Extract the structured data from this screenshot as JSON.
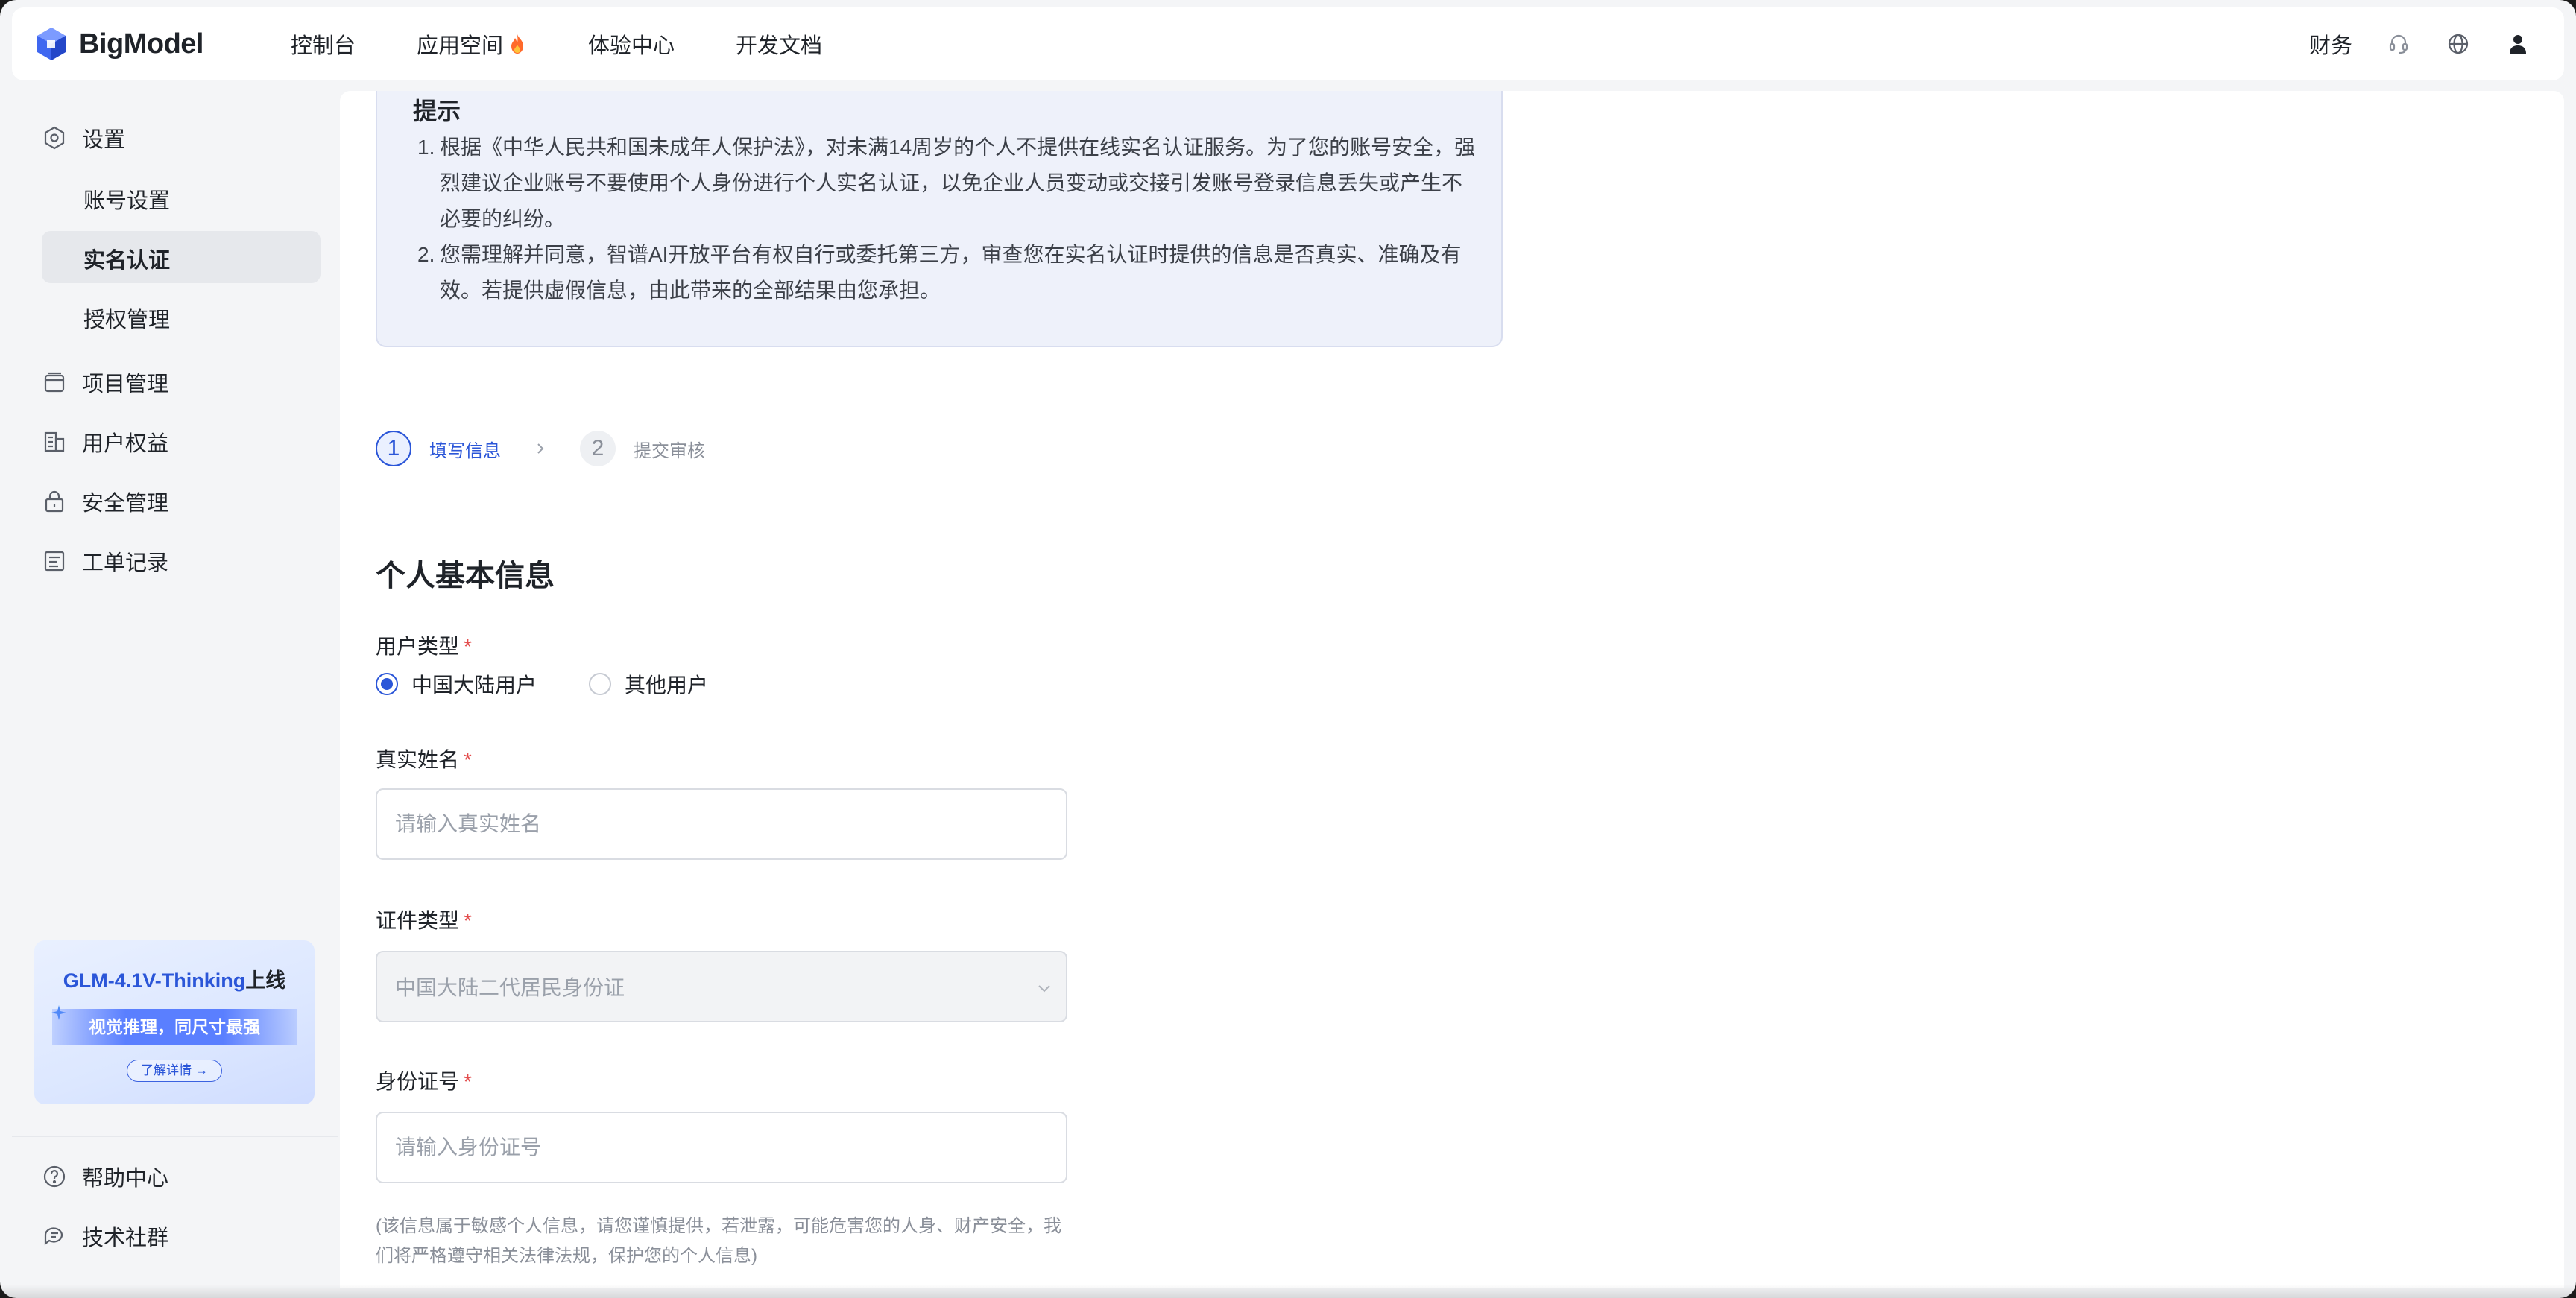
{
  "header": {
    "brand": "BigModel",
    "nav": [
      {
        "label": "控制台"
      },
      {
        "label": "应用空间"
      },
      {
        "label": "体验中心"
      },
      {
        "label": "开发文档"
      }
    ],
    "finance": "财务"
  },
  "sidebar": {
    "settings": "设置",
    "sub_items": [
      "账号设置",
      "实名认证",
      "授权管理"
    ],
    "active_sub": "实名认证",
    "items": [
      "项目管理",
      "用户权益",
      "安全管理",
      "工单记录"
    ],
    "promo": {
      "model": "GLM-4.1V-Thinking",
      "suffix": "上线",
      "tagline": "视觉推理，同尺寸最强",
      "button": "了解详情 →"
    },
    "help": "帮助中心",
    "community": "技术社群"
  },
  "notice": {
    "title": "提示",
    "items": [
      {
        "num": "1.",
        "text": "根据《中华人民共和国未成年人保护法》，对未满14周岁的个人不提供在线实名认证服务。为了您的账号安全，强烈建议企业账号不要使用个人身份进行个人实名认证，以免企业人员变动或交接引发账号登录信息丢失或产生不必要的纠纷。"
      },
      {
        "num": "2.",
        "text": "您需理解并同意，智谱AI开放平台有权自行或委托第三方，审查您在实名认证时提供的信息是否真实、准确及有效。若提供虚假信息，由此带来的全部结果由您承担。"
      }
    ]
  },
  "steps": [
    {
      "num": "1",
      "label": "填写信息",
      "active": true
    },
    {
      "num": "2",
      "label": "提交审核",
      "active": false
    }
  ],
  "form": {
    "section_title": "个人基本信息",
    "user_type_label": "用户类型",
    "user_type_options": [
      "中国大陆用户",
      "其他用户"
    ],
    "user_type_selected": "中国大陆用户",
    "name_label": "真实姓名",
    "name_placeholder": "请输入真实姓名",
    "id_type_label": "证件类型",
    "id_type_value": "中国大陆二代居民身份证",
    "id_number_label": "身份证号",
    "id_number_placeholder": "请输入身份证号",
    "required_mark": "*",
    "hint": "(该信息属于敏感个人信息，请您谨慎提供，若泄露，可能危害您的人身、财产安全，我们将严格遵守相关法律法规，保护您的个人信息)"
  },
  "colors": {
    "accent": "#2b56d8",
    "required": "#e34d4d"
  }
}
